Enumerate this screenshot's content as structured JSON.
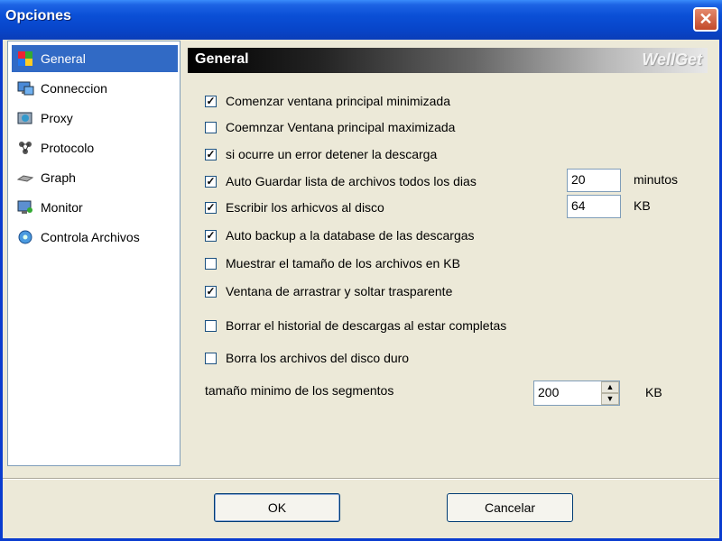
{
  "window": {
    "title": "Opciones",
    "close_label": "✕"
  },
  "sidebar": {
    "items": [
      {
        "label": "General",
        "icon": "general-icon",
        "selected": true
      },
      {
        "label": "Conneccion",
        "icon": "connection-icon",
        "selected": false
      },
      {
        "label": "Proxy",
        "icon": "proxy-icon",
        "selected": false
      },
      {
        "label": "Protocolo",
        "icon": "protocol-icon",
        "selected": false
      },
      {
        "label": "Graph",
        "icon": "graph-icon",
        "selected": false
      },
      {
        "label": "Monitor",
        "icon": "monitor-icon",
        "selected": false
      },
      {
        "label": "Controla Archivos",
        "icon": "file-control-icon",
        "selected": false
      }
    ]
  },
  "panel": {
    "title": "General",
    "brand": "WellGet",
    "options": [
      {
        "label": "Comenzar ventana principal minimizada",
        "checked": true
      },
      {
        "label": "Coemnzar Ventana principal maximizada",
        "checked": false
      },
      {
        "label": "si ocurre un error detener la descarga",
        "checked": true
      },
      {
        "label": "Auto Guardar lista de archivos todos los dias",
        "checked": true
      },
      {
        "label": "Escribir los arhicvos al disco",
        "checked": true
      },
      {
        "label": "Auto backup a la database de las descargas",
        "checked": true
      },
      {
        "label": "Muestrar el tamaño de los archivos en KB",
        "checked": false
      },
      {
        "label": "Ventana de arrastrar y soltar trasparente",
        "checked": true
      },
      {
        "label": "Borrar el historial de descargas al estar completas",
        "checked": false
      },
      {
        "label": "Borra los archivos del disco duro",
        "checked": false
      }
    ],
    "autosave_value": "20",
    "autosave_unit": "minutos",
    "write_value": "64",
    "write_unit": "KB",
    "segment_label": "tamaño minimo de los segmentos",
    "segment_value": "200",
    "segment_unit": "KB"
  },
  "buttons": {
    "ok": "OK",
    "cancel": "Cancelar"
  },
  "colors": {
    "selection": "#316ac5",
    "titlebar": "#0a4fd6",
    "face": "#ece9d8"
  }
}
